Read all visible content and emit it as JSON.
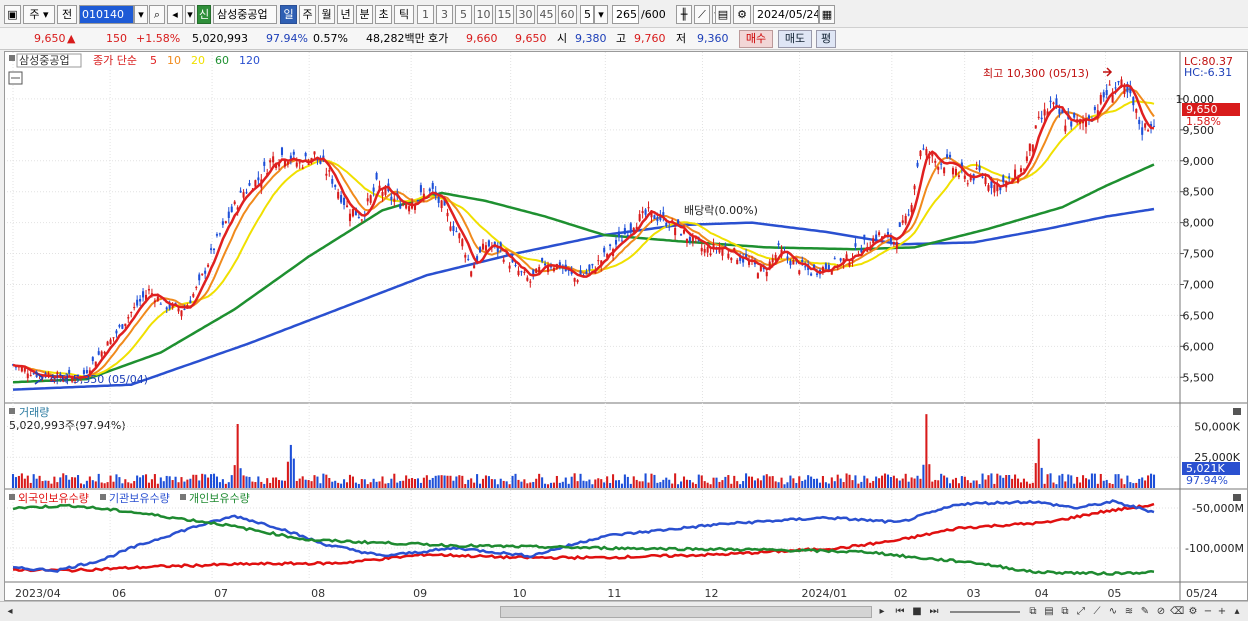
{
  "toolbar": {
    "type_label": "주",
    "prev_label": "전",
    "code": "010140",
    "stock_name": "삼성중공업",
    "new_badge": "신",
    "period_tabs": [
      "일",
      "주",
      "월",
      "년",
      "분",
      "초",
      "틱"
    ],
    "active_period": "일",
    "minute_options": [
      "1",
      "3",
      "5",
      "10",
      "15",
      "30",
      "45",
      "60"
    ],
    "interval_value": "5",
    "count_value": "265",
    "count_total": "/600",
    "date_value": "2024/05/24"
  },
  "info": {
    "price": "9,650",
    "change_arrow": "▲",
    "change": "150",
    "change_pct": "+1.58%",
    "volume": "5,020,993",
    "vol_ratio": "97.94%",
    "turnover": "0.57%",
    "amount": "48,282백만",
    "quote_label": "호가",
    "bid": "9,660",
    "ask": "9,650",
    "open_label": "시",
    "open": "9,380",
    "high_label": "고",
    "high": "9,760",
    "low_label": "저",
    "low": "9,360",
    "buy_label": "매수",
    "sell_label": "매도",
    "eval_label": "평"
  },
  "legend": {
    "name": "삼성중공업",
    "ma_label": "종가 단순",
    "ma_periods": [
      {
        "label": "5",
        "color": "#e02020"
      },
      {
        "label": "10",
        "color": "#f08a1c"
      },
      {
        "label": "20",
        "color": "#f0e000"
      },
      {
        "label": "60",
        "color": "#1e9030"
      },
      {
        "label": "120",
        "color": "#2a50d0"
      }
    ]
  },
  "annotations": {
    "high_note": "최고 10,300 (05/13)",
    "low_note": "최저 5,350 (05/04)",
    "dividend_note": "배당락(0.00%)",
    "lc": "LC:80.37",
    "hc": "HC:-6.31",
    "last_price_tag": "9,650",
    "last_pct_tag": "1.58%"
  },
  "volume_panel": {
    "title": "거래량",
    "value_text": "5,020,993주(97.94%)",
    "last_tag": "5,021K",
    "last_pct": "97.94%"
  },
  "holding_panel": {
    "labels": [
      "외국인보유수량",
      "기관보유수량",
      "개인보유수량"
    ]
  },
  "x_axis_labels": [
    "2023/04",
    "06",
    "07",
    "08",
    "09",
    "10",
    "11",
    "12",
    "2024/01",
    "02",
    "03",
    "04",
    "05",
    "05/24"
  ],
  "colors": {
    "up": "#d81b1b",
    "down": "#1d4fd8",
    "ma5": "#e02020",
    "ma10": "#f08a1c",
    "ma20": "#f0e000",
    "ma60": "#1e9030",
    "ma120": "#2a50d0",
    "foreign": "#e01010",
    "institution": "#2a50d0",
    "individual": "#1e8a30"
  },
  "chart_data": [
    {
      "type": "candlestick",
      "title": "삼성중공업",
      "x_range": [
        "2023/04",
        "2024/05/24"
      ],
      "ylim": [
        5100,
        10500
      ],
      "y_ticks": [
        5500,
        6000,
        6500,
        7000,
        7500,
        8000,
        8500,
        9000,
        9500,
        10000
      ],
      "grid": true,
      "x_months": [
        "2023/04",
        "06",
        "07",
        "08",
        "09",
        "10",
        "11",
        "12",
        "2024/01",
        "02",
        "03",
        "04",
        "05"
      ],
      "close_path": [
        [
          0,
          5700
        ],
        [
          8,
          5550
        ],
        [
          18,
          5500
        ],
        [
          23,
          5500
        ],
        [
          28,
          5800
        ],
        [
          34,
          6150
        ],
        [
          40,
          6550
        ],
        [
          46,
          6900
        ],
        [
          52,
          6650
        ],
        [
          58,
          6600
        ],
        [
          63,
          7000
        ],
        [
          68,
          7600
        ],
        [
          73,
          8100
        ],
        [
          78,
          8500
        ],
        [
          83,
          8700
        ],
        [
          88,
          9050
        ],
        [
          92,
          9100
        ],
        [
          97,
          8950
        ],
        [
          102,
          9100
        ],
        [
          108,
          8700
        ],
        [
          113,
          8250
        ],
        [
          118,
          8100
        ],
        [
          123,
          8600
        ],
        [
          128,
          8400
        ],
        [
          132,
          8300
        ],
        [
          137,
          8400
        ],
        [
          142,
          8500
        ],
        [
          147,
          8100
        ],
        [
          152,
          7700
        ],
        [
          155,
          7250
        ],
        [
          160,
          7650
        ],
        [
          165,
          7550
        ],
        [
          170,
          7250
        ],
        [
          175,
          7050
        ],
        [
          180,
          7350
        ],
        [
          185,
          7300
        ],
        [
          190,
          7100
        ],
        [
          195,
          7200
        ],
        [
          200,
          7450
        ],
        [
          205,
          7700
        ],
        [
          210,
          8000
        ],
        [
          215,
          8150
        ],
        [
          220,
          8050
        ],
        [
          225,
          7900
        ],
        [
          230,
          7700
        ],
        [
          234,
          7550
        ],
        [
          239,
          7600
        ],
        [
          244,
          7500
        ],
        [
          249,
          7350
        ],
        [
          254,
          7200
        ],
        [
          259,
          7550
        ],
        [
          264,
          7350
        ],
        [
          270,
          7200
        ],
        [
          276,
          7300
        ],
        [
          282,
          7400
        ],
        [
          287,
          7600
        ],
        [
          293,
          7800
        ],
        [
          298,
          7700
        ],
        [
          303,
          8100
        ],
        [
          307,
          9200
        ],
        [
          312,
          9000
        ],
        [
          317,
          8950
        ],
        [
          322,
          8700
        ],
        [
          327,
          8800
        ],
        [
          332,
          8600
        ],
        [
          337,
          8650
        ],
        [
          342,
          8900
        ],
        [
          347,
          9600
        ],
        [
          351,
          9900
        ],
        [
          356,
          9650
        ],
        [
          361,
          9600
        ],
        [
          365,
          9750
        ],
        [
          370,
          10100
        ],
        [
          374,
          10250
        ],
        [
          378,
          10000
        ],
        [
          382,
          9500
        ],
        [
          386,
          9650
        ]
      ],
      "ma60_path": [
        [
          0,
          5420
        ],
        [
          25,
          5470
        ],
        [
          50,
          5900
        ],
        [
          75,
          6600
        ],
        [
          100,
          7450
        ],
        [
          125,
          8200
        ],
        [
          145,
          8480
        ],
        [
          160,
          8350
        ],
        [
          180,
          8100
        ],
        [
          200,
          7800
        ],
        [
          225,
          7700
        ],
        [
          255,
          7600
        ],
        [
          285,
          7570
        ],
        [
          305,
          7600
        ],
        [
          330,
          7900
        ],
        [
          355,
          8250
        ],
        [
          370,
          8600
        ],
        [
          386,
          8940
        ]
      ],
      "ma120_path": [
        [
          0,
          5300
        ],
        [
          40,
          5380
        ],
        [
          80,
          6050
        ],
        [
          110,
          6600
        ],
        [
          140,
          7150
        ],
        [
          170,
          7500
        ],
        [
          200,
          7800
        ],
        [
          225,
          7960
        ],
        [
          250,
          8000
        ],
        [
          275,
          7850
        ],
        [
          300,
          7650
        ],
        [
          325,
          7680
        ],
        [
          350,
          7900
        ],
        [
          370,
          8100
        ],
        [
          386,
          8220
        ]
      ],
      "high": {
        "value": 10300,
        "date": "05/13"
      },
      "low": {
        "value": 5350,
        "date": "05/04"
      }
    },
    {
      "type": "bar",
      "title": "거래량",
      "ylim": [
        0,
        65000000
      ],
      "y_ticks": [
        "25,000K",
        "50,000K"
      ],
      "last_value": 5020993,
      "spikes": [
        [
          76,
          52000000
        ],
        [
          94,
          35000000
        ],
        [
          309,
          60000000
        ],
        [
          347,
          40000000
        ]
      ]
    },
    {
      "type": "line",
      "series": [
        {
          "name": "외국인보유수량",
          "values": [
            [
              0,
              -127000
            ],
            [
              20,
              -128000
            ],
            [
              50,
              -123000
            ],
            [
              80,
              -120000
            ],
            [
              110,
              -119000
            ],
            [
              140,
              -108000
            ],
            [
              170,
              -112000
            ],
            [
              200,
              -112000
            ],
            [
              240,
              -108000
            ],
            [
              280,
              -100000
            ],
            [
              300,
              -90000
            ],
            [
              320,
              -75000
            ],
            [
              350,
              -68000
            ],
            [
              368,
              -55000
            ],
            [
              386,
              -46000
            ]
          ]
        },
        {
          "name": "기관보유수량",
          "values": [
            [
              0,
              -125000
            ],
            [
              15,
              -128000
            ],
            [
              30,
              -115000
            ],
            [
              40,
              -100000
            ],
            [
              60,
              -75000
            ],
            [
              75,
              -60000
            ],
            [
              90,
              -75000
            ],
            [
              105,
              -95000
            ],
            [
              125,
              -110000
            ],
            [
              150,
              -100000
            ],
            [
              175,
              -110000
            ],
            [
              200,
              -85000
            ],
            [
              240,
              -70000
            ],
            [
              275,
              -62000
            ],
            [
              300,
              -68000
            ],
            [
              320,
              -45000
            ],
            [
              345,
              -42000
            ],
            [
              360,
              -50000
            ],
            [
              372,
              -42000
            ],
            [
              386,
              -55000
            ]
          ]
        },
        {
          "name": "개인보유수량",
          "values": [
            [
              0,
              -50000
            ],
            [
              20,
              -47000
            ],
            [
              40,
              -55000
            ],
            [
              70,
              -70000
            ],
            [
              100,
              -90000
            ],
            [
              150,
              -97000
            ],
            [
              200,
              -100000
            ],
            [
              250,
              -102000
            ],
            [
              290,
              -105000
            ],
            [
              305,
              -112000
            ],
            [
              325,
              -118000
            ],
            [
              345,
              -130000
            ],
            [
              370,
              -132000
            ],
            [
              386,
              -130000
            ]
          ]
        }
      ],
      "y_ticks": [
        "-50,000M",
        "-100,000M"
      ],
      "x_labels": [
        "2023/04",
        "06",
        "07",
        "08",
        "09",
        "10",
        "11",
        "12",
        "2024/01",
        "02",
        "03",
        "04",
        "05",
        "05/24"
      ]
    }
  ]
}
